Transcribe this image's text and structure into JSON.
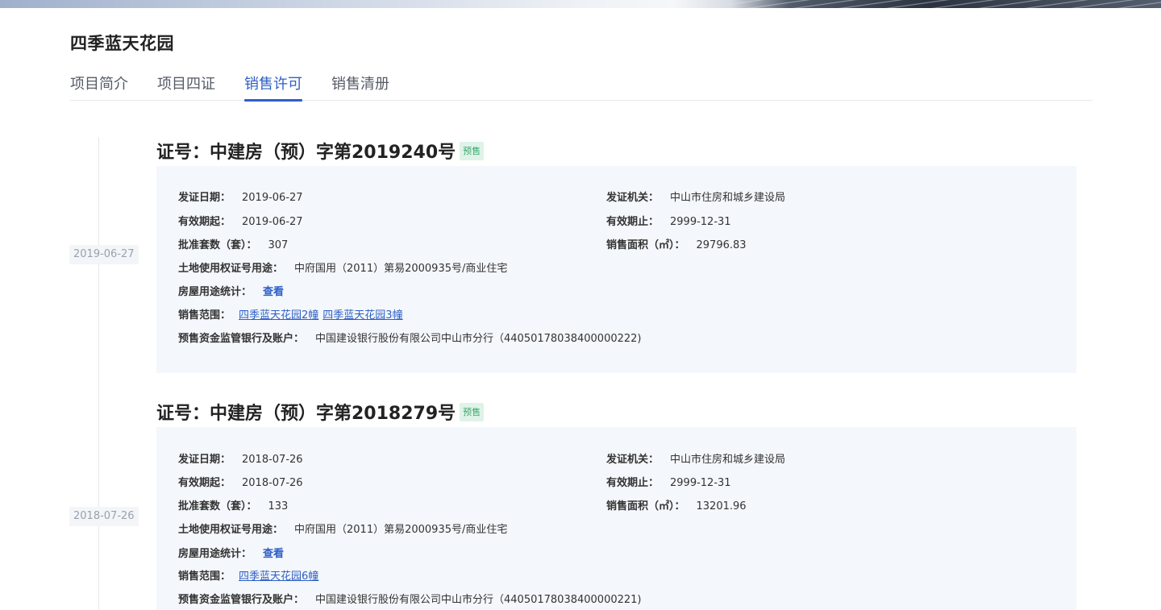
{
  "project": {
    "title": "四季蓝天花园"
  },
  "tabs": [
    {
      "label": "项目简介"
    },
    {
      "label": "项目四证"
    },
    {
      "label": "销售许可"
    },
    {
      "label": "销售清册"
    }
  ],
  "active_tab_index": 2,
  "colors": {
    "accent": "#2e5fc6",
    "badge_text": "#3aa870",
    "badge_bg": "#dff3e8",
    "card_bg": "#f4f7fb"
  },
  "certificates": [
    {
      "timeline_date": "2019-06-27",
      "title": "证号：中建房（预）字第2019240号",
      "badge": "预售",
      "issue_date_label": "发证日期：",
      "issue_date": "2019-06-27",
      "authority_label": "发证机关：",
      "authority": "中山市住房和城乡建设局",
      "valid_from_label": "有效期起：",
      "valid_from": "2019-06-27",
      "valid_to_label": "有效期止：",
      "valid_to": "2999-12-31",
      "approved_units_label": "批准套数（套）：",
      "approved_units": "307",
      "sale_area_label": "销售面积（㎡）：",
      "sale_area": "29796.83",
      "land_label": "土地使用权证号用途：",
      "land": "中府国用（2011）第易2000935号/商业住宅",
      "usage_label": "房屋用途统计：",
      "usage_link": "查看",
      "scope_label": "销售范围：",
      "scope_links": [
        "四季蓝天花园2幢",
        "四季蓝天花园3幢"
      ],
      "bank_label": "预售资金监管银行及账户：",
      "bank": "中国建设银行股份有限公司中山市分行（44050178038400000222)"
    },
    {
      "timeline_date": "2018-07-26",
      "title": "证号：中建房（预）字第2018279号",
      "badge": "预售",
      "issue_date_label": "发证日期：",
      "issue_date": "2018-07-26",
      "authority_label": "发证机关：",
      "authority": "中山市住房和城乡建设局",
      "valid_from_label": "有效期起：",
      "valid_from": "2018-07-26",
      "valid_to_label": "有效期止：",
      "valid_to": "2999-12-31",
      "approved_units_label": "批准套数（套）：",
      "approved_units": "133",
      "sale_area_label": "销售面积（㎡）：",
      "sale_area": "13201.96",
      "land_label": "土地使用权证号用途：",
      "land": "中府国用（2011）第易2000935号/商业住宅",
      "usage_label": "房屋用途统计：",
      "usage_link": "查看",
      "scope_label": "销售范围：",
      "scope_links": [
        "四季蓝天花园6幢"
      ],
      "bank_label": "预售资金监管银行及账户：",
      "bank": "中国建设银行股份有限公司中山市分行（44050178038400000221)"
    }
  ]
}
